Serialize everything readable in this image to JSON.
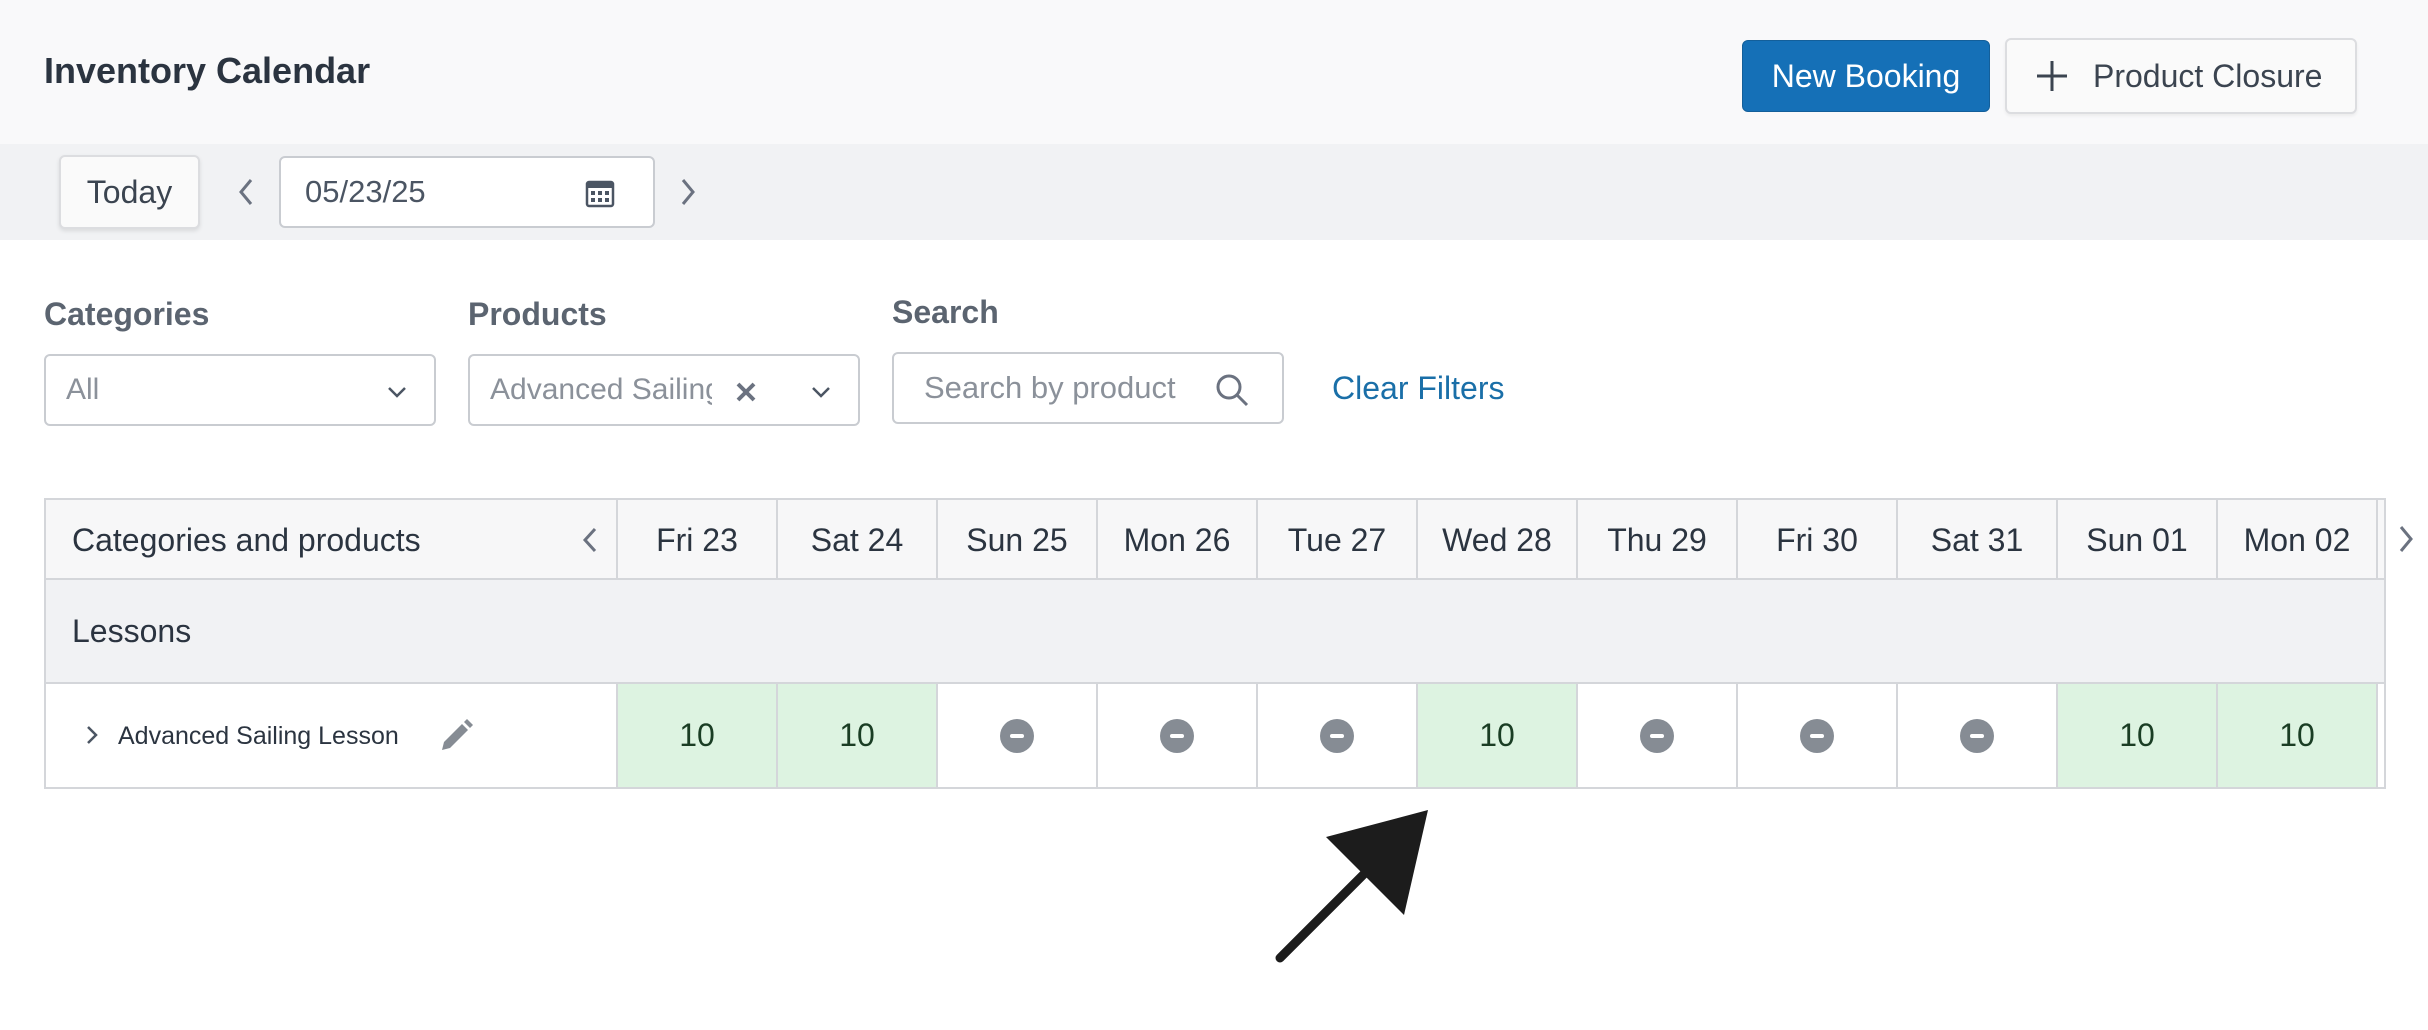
{
  "header": {
    "title": "Inventory Calendar",
    "new_booking_label": "New Booking",
    "product_closure_label": "Product Closure"
  },
  "datebar": {
    "today_label": "Today",
    "date_value": "05/23/25"
  },
  "filters": {
    "categories": {
      "label": "Categories",
      "value": "All"
    },
    "products": {
      "label": "Products",
      "value": "Advanced Sailing Lesson"
    },
    "search": {
      "label": "Search",
      "placeholder": "Search by product"
    },
    "clear_label": "Clear Filters"
  },
  "calendar": {
    "first_column_header": "Categories and products",
    "days": [
      "Fri 23",
      "Sat 24",
      "Sun 25",
      "Mon 26",
      "Tue 27",
      "Wed 28",
      "Thu 29",
      "Fri 30",
      "Sat 31",
      "Sun 01",
      "Mon 02"
    ],
    "group": "Lessons",
    "product": {
      "name": "Advanced Sailing Lesson",
      "cells": [
        "10",
        "10",
        "",
        "",
        "",
        "10",
        "",
        "",
        "",
        "10",
        "10"
      ],
      "status": [
        "available",
        "available",
        "closed",
        "closed",
        "closed",
        "available",
        "closed",
        "closed",
        "closed",
        "available",
        "available"
      ]
    }
  },
  "colors": {
    "primary": "#1570b7",
    "available_bg": "#ddf3e1",
    "closed_icon": "#868c94",
    "link": "#1a6fa8"
  },
  "icons": [
    "plus-icon",
    "chevron-left-icon",
    "chevron-right-icon",
    "calendar-icon",
    "chevron-down-icon",
    "clear-x-icon",
    "search-icon",
    "expand-chevron-icon",
    "pencil-icon",
    "closed-minus-icon",
    "pointer-arrow"
  ]
}
